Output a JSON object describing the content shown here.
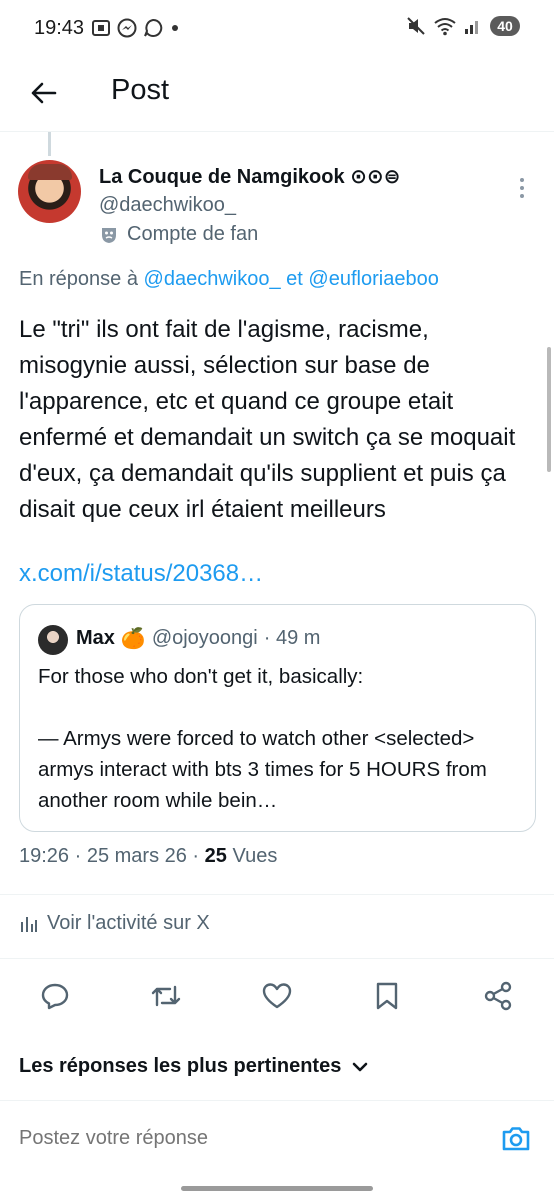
{
  "status_bar": {
    "time": "19:43",
    "battery": "40",
    "left_icons": [
      "screenshot-icon",
      "messenger-icon",
      "chat-bubble-icon",
      "dot-icon"
    ],
    "right_icons": [
      "mute-icon",
      "wifi-icon",
      "signal-icon"
    ]
  },
  "header": {
    "title": "Post"
  },
  "author": {
    "name": "La Couque de Namgikook ⊙⊙⊜",
    "handle": "@daechwikoo_",
    "badge_label": "Compte de fan"
  },
  "reply_to": {
    "prefix": "En réponse à",
    "mention1": "@daechwikoo_",
    "conjunction": "et",
    "mention2": "@eufloriaeboo"
  },
  "post": {
    "text": "Le \"tri\" ils ont fait de l'agisme, racisme, misogynie aussi, sélection sur base de l'apparence, etc et quand ce groupe etait enfermé et demandait un switch ça se moquait d'eux, ça demandait qu'ils supplient et puis ça disait que ceux irl étaient meilleurs",
    "link": "x.com/i/status/20368…"
  },
  "quote": {
    "name": "Max",
    "emoji": "🍊",
    "handle": "@ojoyoongi",
    "time": "· 49 m",
    "line1": "For those who don't get it, basically:",
    "line2": "— Armys were forced to watch other <selected> armys interact with bts 3 times for 5 HOURS from another room while bein…"
  },
  "meta": {
    "time_date": "19:26 · 25 mars 26 ·",
    "views_count": "25",
    "views_label": "Vues"
  },
  "activity_label": "Voir l'activité sur X",
  "actions": [
    "reply-icon",
    "retweet-icon",
    "like-icon",
    "bookmark-icon",
    "share-icon"
  ],
  "sort_label": "Les réponses les plus pertinentes",
  "compose": {
    "placeholder": "Postez votre réponse"
  },
  "colors": {
    "accent": "#1d9bf0",
    "text": "#0f1419",
    "secondary": "#536471",
    "border": "#cfd9de"
  }
}
